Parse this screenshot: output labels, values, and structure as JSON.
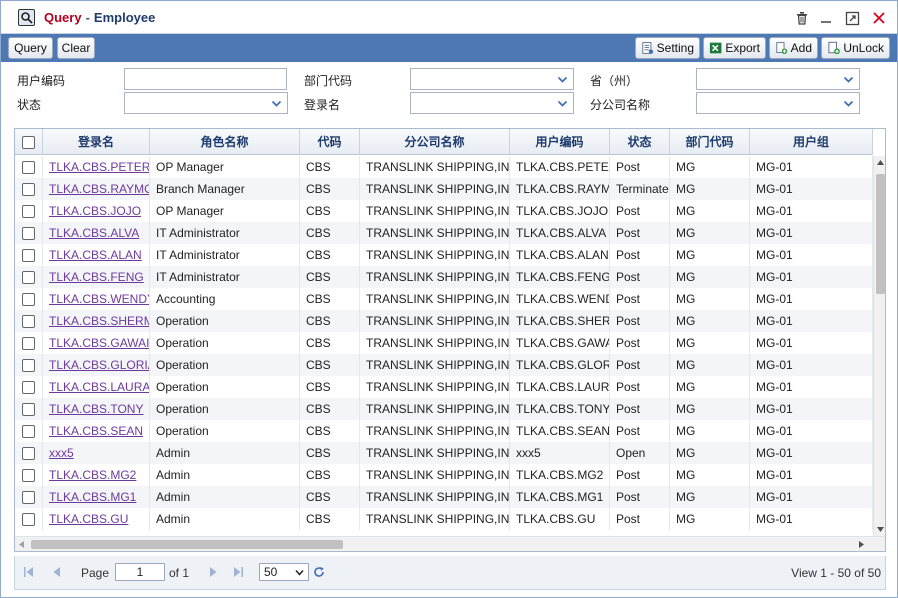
{
  "window": {
    "title_prefix": "Query",
    "title_separator": "-",
    "title": "Employee"
  },
  "toolbar": {
    "query_label": "Query",
    "clear_label": "Clear",
    "setting_label": "Setting",
    "export_label": "Export",
    "add_label": "Add",
    "unlock_label": "UnLock"
  },
  "filters": {
    "user_code_label": "用户编码",
    "dept_code_label": "部门代码",
    "province_label": "省（州）",
    "status_label": "状态",
    "login_name_label": "登录名",
    "branch_name_label": "分公司名称",
    "user_code_value": "",
    "dept_code_value": "",
    "province_value": "",
    "status_value": "",
    "login_name_value": "",
    "branch_name_value": ""
  },
  "grid": {
    "columns": [
      "登录名",
      "角色名称",
      "代码",
      "分公司名称",
      "用户编码",
      "状态",
      "部门代码",
      "用户组"
    ],
    "rows": [
      [
        "TLKA.CBS.PETER",
        "OP Manager",
        "CBS",
        "TRANSLINK SHIPPING,IN",
        "TLKA.CBS.PETE",
        "Post",
        "MG",
        "MG-01"
      ],
      [
        "TLKA.CBS.RAYMO",
        "Branch Manager",
        "CBS",
        "TRANSLINK SHIPPING,IN",
        "TLKA.CBS.RAYM",
        "Terminate",
        "MG",
        "MG-01"
      ],
      [
        "TLKA.CBS.JOJO",
        "OP Manager",
        "CBS",
        "TRANSLINK SHIPPING,IN",
        "TLKA.CBS.JOJO",
        "Post",
        "MG",
        "MG-01"
      ],
      [
        "TLKA.CBS.ALVA",
        "IT Administrator",
        "CBS",
        "TRANSLINK SHIPPING,IN",
        "TLKA.CBS.ALVA",
        "Post",
        "MG",
        "MG-01"
      ],
      [
        "TLKA.CBS.ALAN",
        "IT Administrator",
        "CBS",
        "TRANSLINK SHIPPING,IN",
        "TLKA.CBS.ALAN",
        "Post",
        "MG",
        "MG-01"
      ],
      [
        "TLKA.CBS.FENG",
        "IT Administrator",
        "CBS",
        "TRANSLINK SHIPPING,IN",
        "TLKA.CBS.FENG",
        "Post",
        "MG",
        "MG-01"
      ],
      [
        "TLKA.CBS.WENDY",
        "Accounting",
        "CBS",
        "TRANSLINK SHIPPING,IN",
        "TLKA.CBS.WEND",
        "Post",
        "MG",
        "MG-01"
      ],
      [
        "TLKA.CBS.SHERM",
        "Operation",
        "CBS",
        "TRANSLINK SHIPPING,IN",
        "TLKA.CBS.SHER",
        "Post",
        "MG",
        "MG-01"
      ],
      [
        "TLKA.CBS.GAWAI",
        "Operation",
        "CBS",
        "TRANSLINK SHIPPING,IN",
        "TLKA.CBS.GAWA",
        "Post",
        "MG",
        "MG-01"
      ],
      [
        "TLKA.CBS.GLORIA",
        "Operation",
        "CBS",
        "TRANSLINK SHIPPING,IN",
        "TLKA.CBS.GLOR",
        "Post",
        "MG",
        "MG-01"
      ],
      [
        "TLKA.CBS.LAURA",
        "Operation",
        "CBS",
        "TRANSLINK SHIPPING,IN",
        "TLKA.CBS.LAUR",
        "Post",
        "MG",
        "MG-01"
      ],
      [
        "TLKA.CBS.TONY",
        "Operation",
        "CBS",
        "TRANSLINK SHIPPING,IN",
        "TLKA.CBS.TONY",
        "Post",
        "MG",
        "MG-01"
      ],
      [
        "TLKA.CBS.SEAN",
        "Operation",
        "CBS",
        "TRANSLINK SHIPPING,IN",
        "TLKA.CBS.SEAN",
        "Post",
        "MG",
        "MG-01"
      ],
      [
        "xxx5",
        "Admin",
        "CBS",
        "TRANSLINK SHIPPING,IN",
        "xxx5",
        "Open",
        "MG",
        "MG-01"
      ],
      [
        "TLKA.CBS.MG2",
        "Admin",
        "CBS",
        "TRANSLINK SHIPPING,IN",
        "TLKA.CBS.MG2",
        "Post",
        "MG",
        "MG-01"
      ],
      [
        "TLKA.CBS.MG1",
        "Admin",
        "CBS",
        "TRANSLINK SHIPPING,IN",
        "TLKA.CBS.MG1",
        "Post",
        "MG",
        "MG-01"
      ],
      [
        "TLKA.CBS.GU",
        "Admin",
        "CBS",
        "TRANSLINK SHIPPING,IN",
        "TLKA.CBS.GU",
        "Post",
        "MG",
        "MG-01"
      ]
    ]
  },
  "pager": {
    "page_label": "Page",
    "page_value": "1",
    "of_label": "of 1",
    "page_size": "50",
    "summary": "View 1 - 50 of 50"
  },
  "icons": {
    "app": "search-window-icon",
    "delete": "trash-icon",
    "minimize": "minimize-icon",
    "maximize": "maximize-icon",
    "close": "close-icon"
  },
  "colors": {
    "toolbar": "#4e78b4",
    "title_prefix": "#b3001b",
    "title": "#1f3c6e",
    "link": "#6d3a9c",
    "close": "#d9001b"
  }
}
